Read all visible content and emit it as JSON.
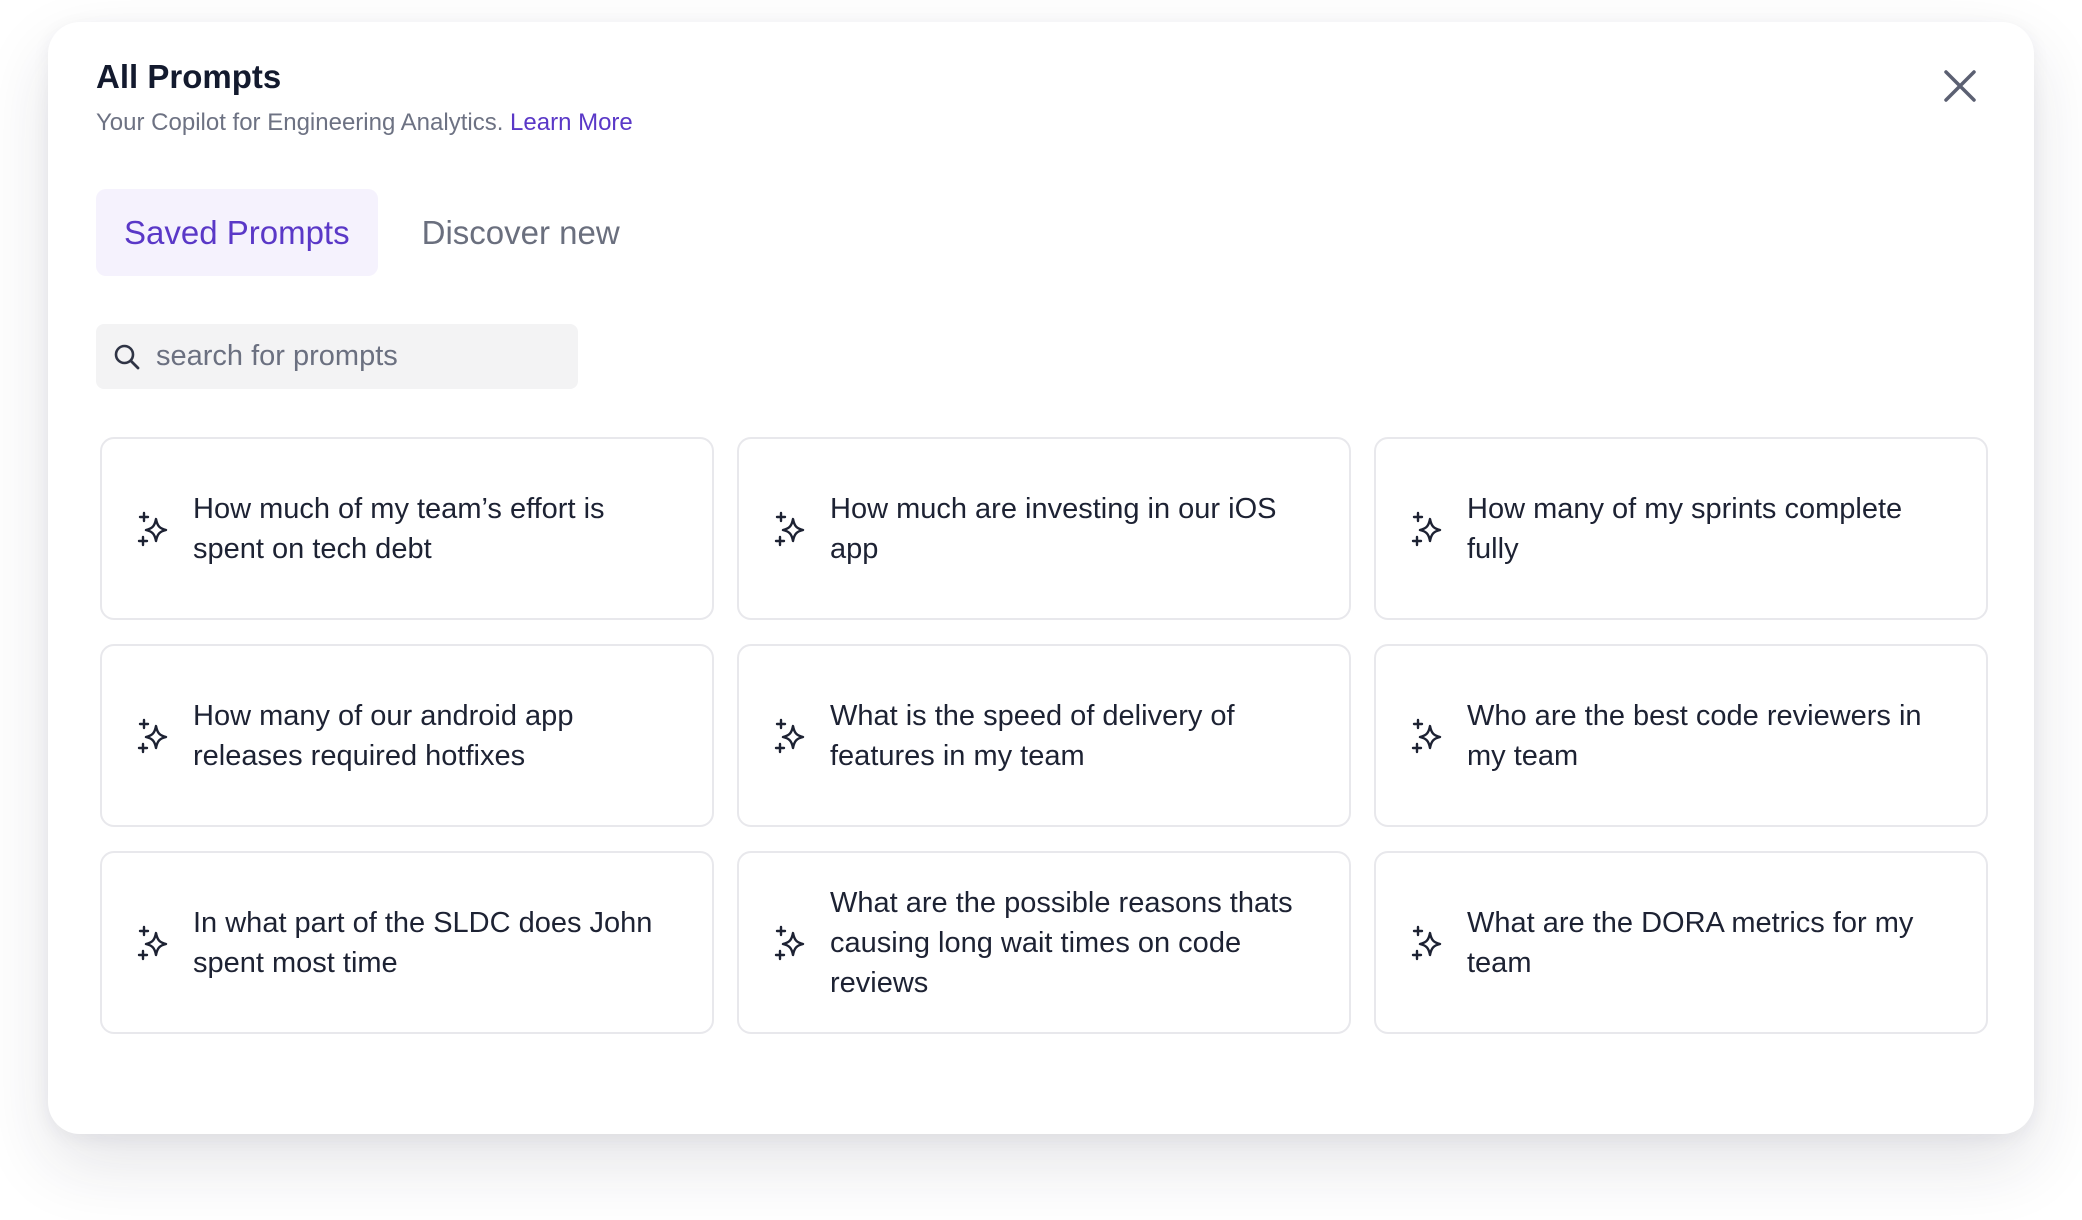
{
  "header": {
    "title": "All Prompts",
    "subtitle": "Your Copilot for Engineering Analytics.",
    "learn_more": "Learn More",
    "close_icon": "close-icon"
  },
  "tabs": [
    {
      "label": "Saved Prompts",
      "active": true
    },
    {
      "label": "Discover new",
      "active": false
    }
  ],
  "search": {
    "placeholder": "search for prompts",
    "value": "",
    "icon": "search-icon"
  },
  "prompts": [
    {
      "text": "How much of my team’s effort is spent on tech debt",
      "icon": "sparkle-icon"
    },
    {
      "text": "How much are investing in our iOS app",
      "icon": "sparkle-icon"
    },
    {
      "text": "How many of my sprints complete fully",
      "icon": "sparkle-icon"
    },
    {
      "text": "How many of our android app releases required hotfixes",
      "icon": "sparkle-icon"
    },
    {
      "text": "What is the speed of delivery of features in my team",
      "icon": "sparkle-icon"
    },
    {
      "text": "Who are the best code reviewers in my team",
      "icon": "sparkle-icon"
    },
    {
      "text": "In what part of the SLDC does John spent most time",
      "icon": "sparkle-icon"
    },
    {
      "text": "What are the possible reasons thats causing long wait times on code reviews",
      "icon": "sparkle-icon"
    },
    {
      "text": "What are the DORA metrics for my team",
      "icon": "sparkle-icon"
    }
  ],
  "colors": {
    "accent": "#5a38c7",
    "active_tab_bg": "#f5f2fd",
    "title": "#131a2e",
    "muted": "#6d7283"
  }
}
